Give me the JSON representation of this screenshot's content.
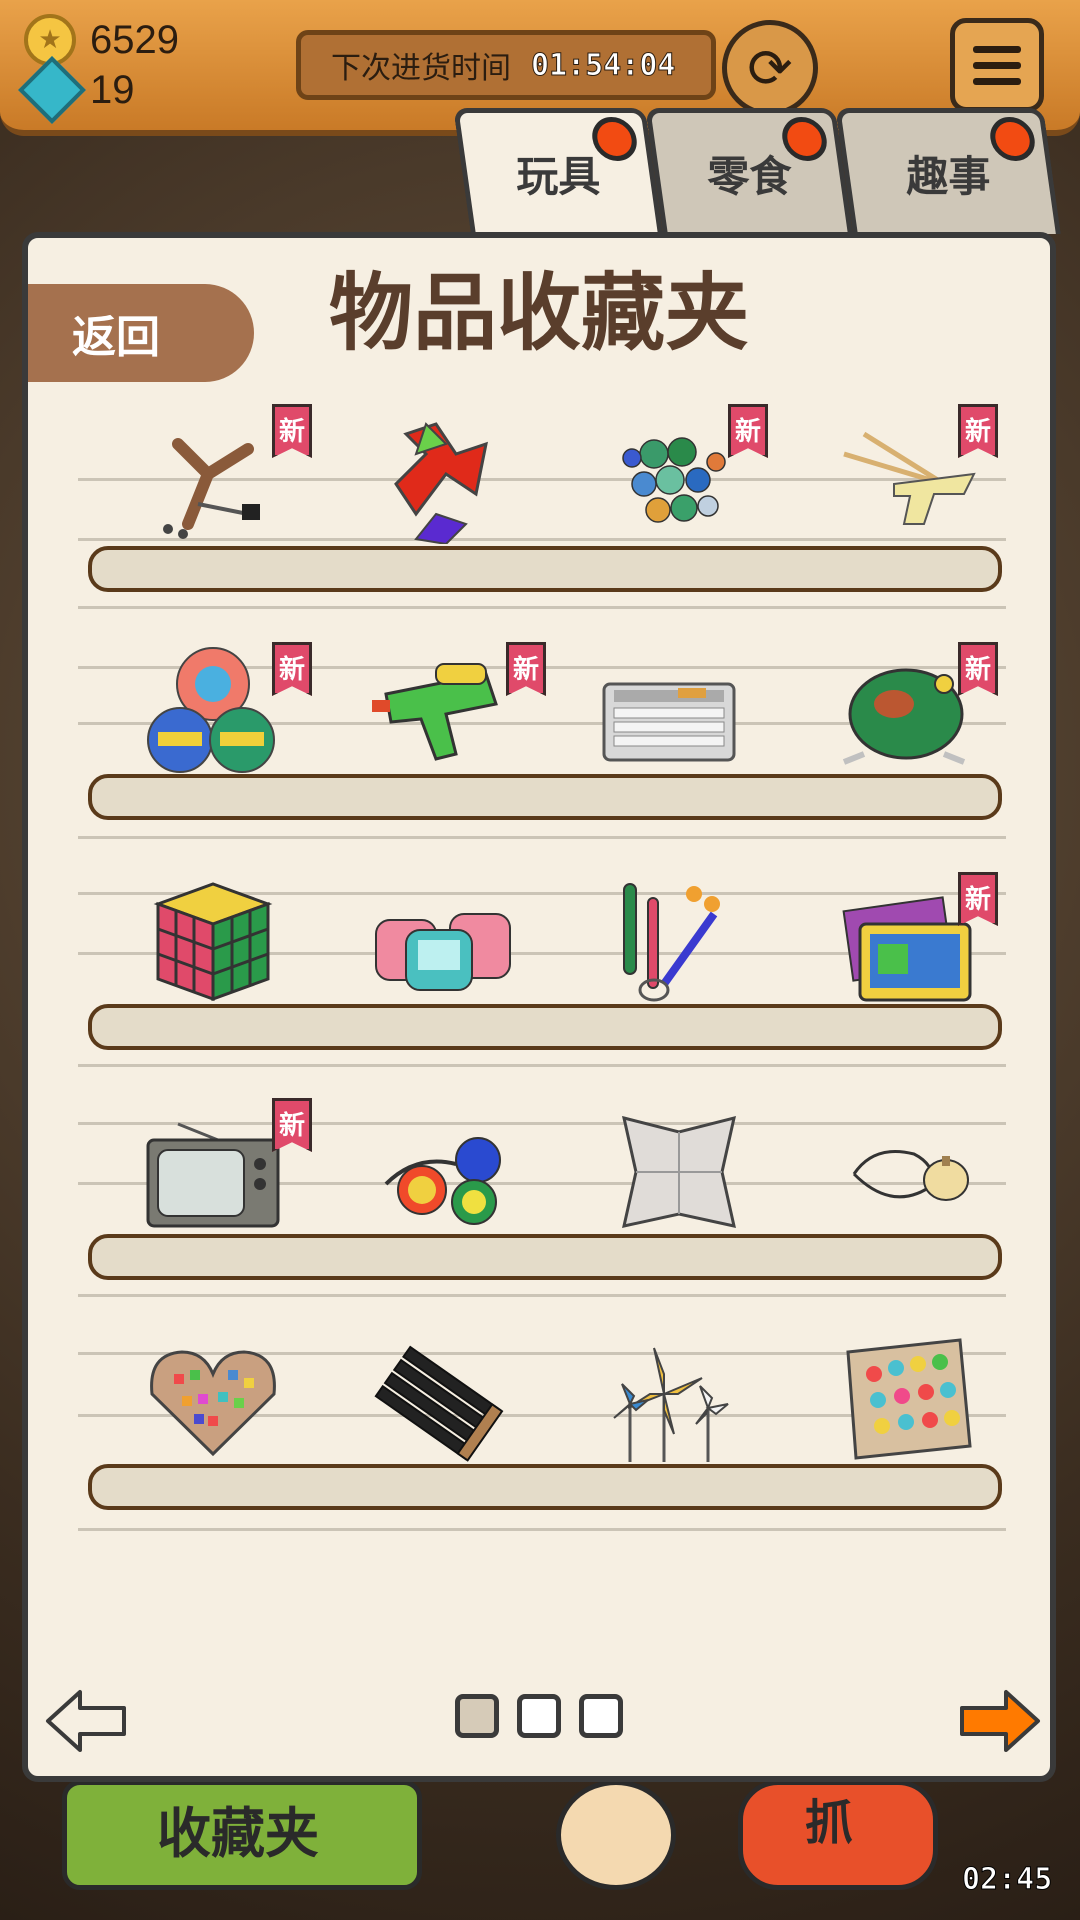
{
  "resources": {
    "coins": "6529",
    "gems": "19"
  },
  "restock": {
    "label": "下次进货时间",
    "time": "01:54:04"
  },
  "tabs": [
    {
      "label": "玩具",
      "active": true
    },
    {
      "label": "零食",
      "active": false
    },
    {
      "label": "趣事",
      "active": false
    }
  ],
  "panel": {
    "title": "物品收藏夹",
    "back_label": "返回",
    "new_badge": "新"
  },
  "shelves": [
    {
      "items": [
        {
          "icon": "slingshot",
          "is_new": true
        },
        {
          "icon": "sticky-hands",
          "is_new": false
        },
        {
          "icon": "marbles",
          "is_new": true
        },
        {
          "icon": "toy-gun-chopsticks",
          "is_new": true
        }
      ]
    },
    {
      "items": [
        {
          "icon": "pog-discs",
          "is_new": true
        },
        {
          "icon": "water-gun",
          "is_new": true
        },
        {
          "icon": "learning-computer-keyboard",
          "is_new": false
        },
        {
          "icon": "tin-frog",
          "is_new": true
        }
      ]
    },
    {
      "items": [
        {
          "icon": "rubiks-cube",
          "is_new": false
        },
        {
          "icon": "water-ring-games",
          "is_new": false
        },
        {
          "icon": "keychain-toys",
          "is_new": false
        },
        {
          "icon": "game-cartridge",
          "is_new": true
        }
      ]
    },
    {
      "items": [
        {
          "icon": "old-television",
          "is_new": true
        },
        {
          "icon": "clacker-balls",
          "is_new": false
        },
        {
          "icon": "paper-fortune-teller",
          "is_new": false
        },
        {
          "icon": "spinning-top-whip",
          "is_new": false
        }
      ]
    },
    {
      "items": [
        {
          "icon": "paper-cranes-heart-box",
          "is_new": false
        },
        {
          "icon": "cap-gun-caps",
          "is_new": false
        },
        {
          "icon": "pinwheels",
          "is_new": false
        },
        {
          "icon": "plastic-pegs-box",
          "is_new": false
        }
      ]
    }
  ],
  "pagination": {
    "pages": 3,
    "current": 1
  },
  "bottom": {
    "collection_label": "收藏夹",
    "grab_label": "抓",
    "clock": "02:45"
  },
  "colors": {
    "accent_orange": "#ff7a00",
    "badge_pink": "#e04a6a",
    "tab_dot": "#f24b12",
    "panel_bg": "#f6efe2"
  }
}
